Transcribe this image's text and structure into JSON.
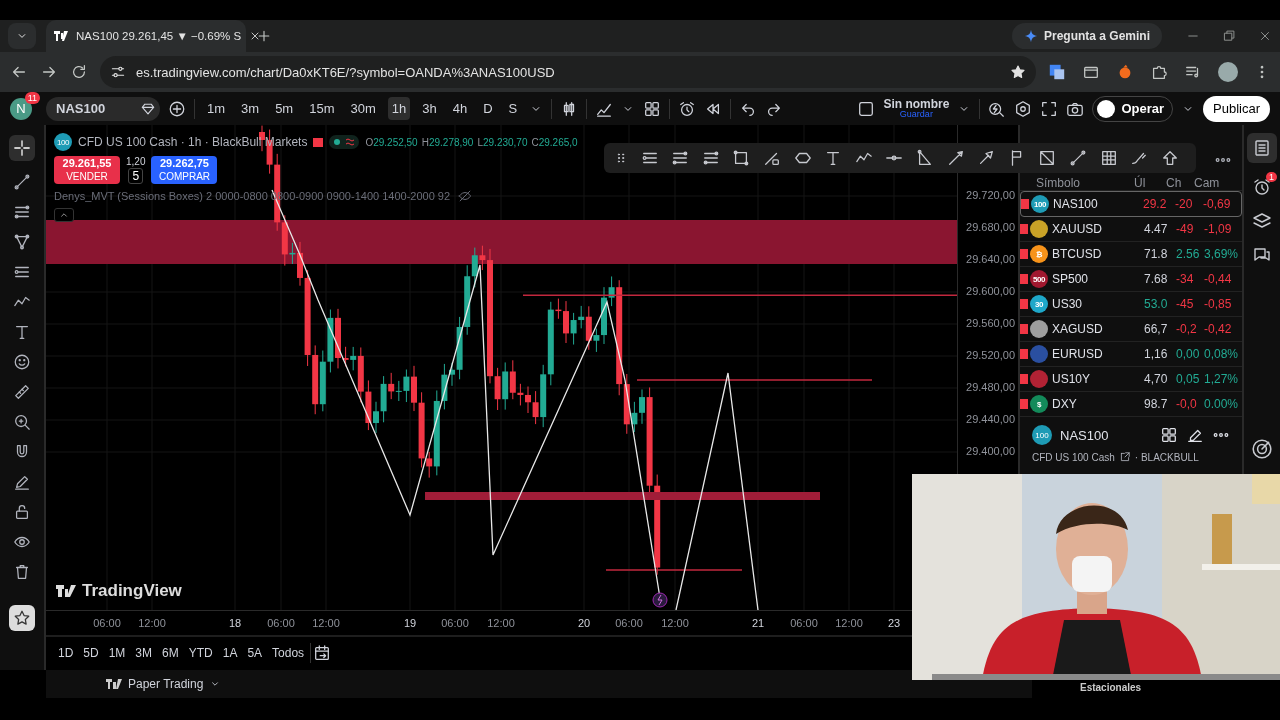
{
  "browser": {
    "tab": {
      "title": "NAS100 29.261,45 ▼ −0.69% S"
    },
    "assistant_button": "Pregunta a Gemini",
    "url": "es.tradingview.com/chart/Da0xKT6E/?symbol=OANDA%3ANAS100USD"
  },
  "toolbar": {
    "avatar": "N",
    "notifications": "11",
    "symbol": "NAS100",
    "intervals": [
      {
        "label": "1m",
        "selected": false
      },
      {
        "label": "3m",
        "selected": false
      },
      {
        "label": "5m",
        "selected": false
      },
      {
        "label": "15m",
        "selected": false
      },
      {
        "label": "30m",
        "selected": false
      },
      {
        "label": "1h",
        "selected": true
      },
      {
        "label": "3h",
        "selected": false
      },
      {
        "label": "4h",
        "selected": false
      },
      {
        "label": "D",
        "selected": false
      },
      {
        "label": "S",
        "selected": false
      }
    ],
    "layout_name": "Sin nombre",
    "save_label": "Guardar",
    "trade_button": "Operar",
    "publish_button": "Publicar"
  },
  "chart": {
    "badge": "100",
    "title": "CFD US 100 Cash · 1h · BlackBull Markets",
    "ohlc": [
      {
        "key": "O",
        "value": "29.252,50"
      },
      {
        "key": "H",
        "value": "29.278,90"
      },
      {
        "key": "L",
        "value": "29.230,70"
      },
      {
        "key": "C",
        "value": "29.265,0"
      }
    ],
    "sell": {
      "price": "29.261,55",
      "label": "VENDER"
    },
    "spread": "1,20",
    "quantity": "5",
    "buy": {
      "price": "29.262,75",
      "label": "COMPRAR"
    },
    "indicator": "Denys_MVT (Sessions Boxes) 2 0000-0800 0800-0900 0900-1400 1400-2000 92",
    "logo": "TradingView",
    "price_ticks": [
      "29.720,00",
      "29.680,00",
      "29.640,00",
      "29.600,00",
      "29.560,00",
      "29.520,00",
      "29.480,00",
      "29.440,00",
      "29.400,00"
    ],
    "time_ticks": [
      {
        "label": "06:00",
        "kind": "time"
      },
      {
        "label": "12:00",
        "kind": "time"
      },
      {
        "label": "18",
        "kind": "day"
      },
      {
        "label": "06:00",
        "kind": "time"
      },
      {
        "label": "12:00",
        "kind": "time"
      },
      {
        "label": "19",
        "kind": "day"
      },
      {
        "label": "06:00",
        "kind": "time"
      },
      {
        "label": "12:00",
        "kind": "time"
      },
      {
        "label": "20",
        "kind": "day"
      },
      {
        "label": "06:00",
        "kind": "time"
      },
      {
        "label": "12:00",
        "kind": "time"
      },
      {
        "label": "21",
        "kind": "day"
      },
      {
        "label": "06:00",
        "kind": "time"
      },
      {
        "label": "12:00",
        "kind": "time"
      },
      {
        "label": "23",
        "kind": "day"
      }
    ]
  },
  "ranges": [
    "1D",
    "5D",
    "1M",
    "3M",
    "6M",
    "YTD",
    "1A",
    "5A",
    "Todos"
  ],
  "bottom": {
    "account": "Paper Trading"
  },
  "watchlist": {
    "columns": [
      "Símbolo",
      "Úl",
      "Ch",
      "Cam"
    ],
    "rows": [
      {
        "symbol": "NAS100",
        "badge": "100",
        "color": "#1e9bb5",
        "last": {
          "text": "29.2",
          "color": "#f23645"
        },
        "change": {
          "text": "-20",
          "color": "#f23645"
        },
        "percent": {
          "text": "-0,69",
          "color": "#f23645"
        },
        "selected": true
      },
      {
        "symbol": "XAUUSD",
        "color": "#c9a227",
        "last": {
          "text": "4.47",
          "color": "#d1d4dc"
        },
        "change": {
          "text": "-49",
          "color": "#f23645"
        },
        "percent": {
          "text": "-1,09",
          "color": "#f23645"
        },
        "selected": false
      },
      {
        "symbol": "BTCUSD",
        "badge": "₿",
        "color": "#f7931a",
        "last": {
          "text": "71.8",
          "color": "#d1d4dc"
        },
        "change": {
          "text": "2.56",
          "color": "#22ab94"
        },
        "percent": {
          "text": "3,69%",
          "color": "#22ab94"
        },
        "selected": false
      },
      {
        "symbol": "SP500",
        "badge": "500",
        "color": "#a0182f",
        "last": {
          "text": "7.68",
          "color": "#d1d4dc"
        },
        "change": {
          "text": "-34",
          "color": "#f23645"
        },
        "percent": {
          "text": "-0,44",
          "color": "#f23645"
        },
        "selected": false
      },
      {
        "symbol": "US30",
        "badge": "30",
        "color": "#1ea7c9",
        "last": {
          "text": "53.0",
          "color": "#22ab94"
        },
        "change": {
          "text": "-45",
          "color": "#f23645"
        },
        "percent": {
          "text": "-0,85",
          "color": "#f23645"
        },
        "selected": false
      },
      {
        "symbol": "XAGUSD",
        "color": "#9e9e9e",
        "last": {
          "text": "66,7",
          "color": "#d1d4dc"
        },
        "change": {
          "text": "-0,2",
          "color": "#f23645"
        },
        "percent": {
          "text": "-0,42",
          "color": "#f23645"
        },
        "selected": false
      },
      {
        "symbol": "EURUSD",
        "color": "#2a4fa0",
        "last": {
          "text": "1,16",
          "color": "#d1d4dc"
        },
        "change": {
          "text": "0,00",
          "color": "#22ab94"
        },
        "percent": {
          "text": "0,08%",
          "color": "#22ab94"
        },
        "selected": false
      },
      {
        "symbol": "US10Y",
        "color": "#b22234",
        "last": {
          "text": "4,70",
          "color": "#d1d4dc"
        },
        "change": {
          "text": "0,05",
          "color": "#22ab94"
        },
        "percent": {
          "text": "1,27%",
          "color": "#22ab94"
        },
        "selected": false
      },
      {
        "symbol": "DXY",
        "badge": "$",
        "color": "#138a5a",
        "last": {
          "text": "98.7",
          "color": "#d1d4dc"
        },
        "change": {
          "text": "-0,0",
          "color": "#f23645"
        },
        "percent": {
          "text": "0.00%",
          "color": "#22ab94"
        },
        "selected": false
      }
    ],
    "details": {
      "badge": "100",
      "symbol": "NAS100",
      "description": "CFD US 100 Cash",
      "exchange": "· BLACKBULL"
    },
    "seasonals": "Estacionales"
  },
  "alerts_badge": "1",
  "webcam": {
    "kind": "picture"
  }
}
